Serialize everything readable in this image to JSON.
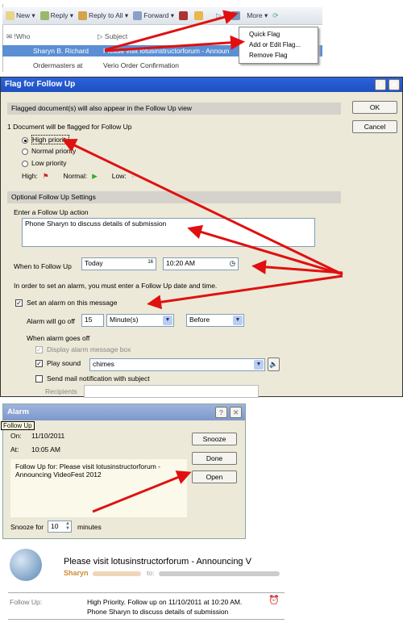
{
  "toolbar": {
    "new": "New",
    "reply": "Reply",
    "reply_all": "Reply to All",
    "forward": "Forward",
    "more": "More"
  },
  "list": {
    "col_who": "Who",
    "col_subject": "Subject",
    "rows": [
      {
        "who": "Sharyn B. Richard",
        "subject": "Please visit lotusinstructorforum - Announ"
      },
      {
        "who": "Ordermasters at",
        "subject": "Verio Order Confirmation"
      }
    ]
  },
  "flag_menu": {
    "items": [
      "Quick Flag",
      "Add or Edit Flag...",
      "Remove Flag"
    ]
  },
  "flag_dialog": {
    "title": "Flag for Follow Up",
    "help": "?",
    "close": "✕",
    "info": "Flagged document(s) will also appear in the Follow Up view",
    "count_text": "1 Document will be flagged for Follow Up",
    "priorities": [
      "High priority",
      "Normal priority",
      "Low priority"
    ],
    "selected_priority": "High priority",
    "legend": {
      "high": "High:",
      "normal": "Normal:",
      "low": "Low:"
    },
    "ok": "OK",
    "cancel": "Cancel",
    "optional_header": "Optional Follow Up Settings",
    "action_label": "Enter a Follow Up action",
    "action_value": "Phone Sharyn to discuss details of submission",
    "when_label": "When to Follow Up",
    "date_value": "Today",
    "date_icon": "16",
    "time_value": "10:20 AM",
    "alarm_note": "In order to set an alarm, you must enter a Follow Up date and time.",
    "set_alarm": "Set an alarm on this message",
    "set_alarm_checked": true,
    "alarm_go_off": "Alarm will go off",
    "alarm_amount": "15",
    "alarm_unit": "Minute(s)",
    "alarm_when": "Before",
    "when_goes_off": "When alarm goes off",
    "display_box": "Display alarm message box",
    "play_sound": "Play sound",
    "sound_value": "chimes",
    "send_mail": "Send mail notification with subject",
    "recipients": "Recipients"
  },
  "alarm": {
    "title": "Alarm",
    "help": "?",
    "close": "✕",
    "tooltip": "Follow Up",
    "on_label": "On:",
    "on_value": "11/10/2011",
    "at_label": "At:",
    "at_value": "10:05 AM",
    "message": "Follow Up for:  Please visit lotusinstructorforum - Announcing VideoFest 2012",
    "snooze": "Snooze",
    "done": "Done",
    "open": "Open",
    "snooze_for": "Snooze for",
    "snooze_value": "10",
    "minutes": "minutes"
  },
  "email": {
    "subject": "Please visit lotusinstructorforum - Announcing V",
    "from": "Sharyn",
    "to_label": "to:",
    "followup_label": "Follow Up:",
    "followup_line1": "High Priority.  Follow up on 11/10/2011 at 10:20 AM.",
    "followup_line2": "Phone Sharyn to discuss details of submission"
  },
  "colors": {
    "arrow": "#e01010",
    "title_bar": "#1f4fc1",
    "selected_row": "#5b8fd4",
    "dialog_bg": "#ece9d8"
  }
}
